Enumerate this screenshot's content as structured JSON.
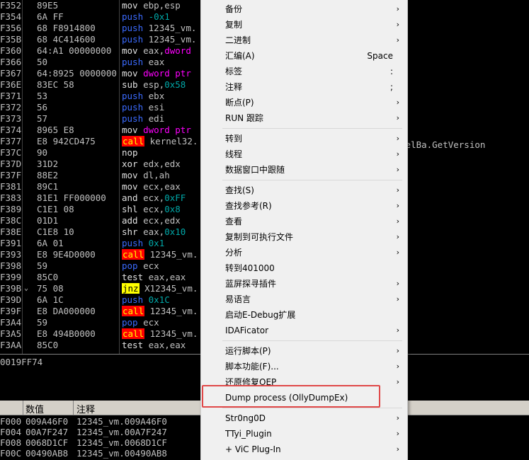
{
  "disasm": {
    "rows": [
      {
        "addr": "F352",
        "hex": "89E5",
        "mn": "mov",
        "op": [
          [
            "t",
            "ebp,esp"
          ]
        ]
      },
      {
        "addr": "F354",
        "hex": "6A FF",
        "mn": "push",
        "op": [
          [
            "n",
            "-0x1"
          ]
        ]
      },
      {
        "addr": "F356",
        "hex": "68 F8914800",
        "mn": "push",
        "op": [
          [
            "t",
            "12345_vm."
          ]
        ]
      },
      {
        "addr": "F35B",
        "hex": "68 4C414600",
        "mn": "push",
        "op": [
          [
            "t",
            "12345_vm."
          ]
        ]
      },
      {
        "addr": "F360",
        "hex": "64:A1 00000000",
        "mn": "mov",
        "op": [
          [
            "t",
            "eax,"
          ],
          [
            "k",
            "dword"
          ]
        ]
      },
      {
        "addr": "F366",
        "hex": "50",
        "mn": "push",
        "op": [
          [
            "t",
            "eax"
          ]
        ]
      },
      {
        "addr": "F367",
        "hex": "64:8925 0000000",
        "mn": "mov",
        "op": [
          [
            "k",
            "dword ptr"
          ]
        ]
      },
      {
        "addr": "F36E",
        "hex": "83EC 58",
        "mn": "sub",
        "op": [
          [
            "t",
            "esp,"
          ],
          [
            "n",
            "0x58"
          ]
        ]
      },
      {
        "addr": "F371",
        "hex": "53",
        "mn": "push",
        "op": [
          [
            "t",
            "ebx"
          ]
        ]
      },
      {
        "addr": "F372",
        "hex": "56",
        "mn": "push",
        "op": [
          [
            "t",
            "esi"
          ]
        ]
      },
      {
        "addr": "F373",
        "hex": "57",
        "mn": "push",
        "op": [
          [
            "t",
            "edi"
          ]
        ]
      },
      {
        "addr": "F374",
        "hex": "8965 E8",
        "mn": "mov",
        "op": [
          [
            "k",
            "dword ptr"
          ]
        ]
      },
      {
        "addr": "F377",
        "hex": "E8 942CD475",
        "mn": "call",
        "op": [
          [
            "t",
            "kernel32."
          ]
        ]
      },
      {
        "addr": "F37C",
        "hex": "90",
        "mn": "nop",
        "op": []
      },
      {
        "addr": "F37D",
        "hex": "31D2",
        "mn": "xor",
        "op": [
          [
            "t",
            "edx,edx"
          ]
        ]
      },
      {
        "addr": "F37F",
        "hex": "88E2",
        "mn": "mov",
        "op": [
          [
            "t",
            "dl,ah"
          ]
        ]
      },
      {
        "addr": "F381",
        "hex": "89C1",
        "mn": "mov",
        "op": [
          [
            "t",
            "ecx,eax"
          ]
        ]
      },
      {
        "addr": "F383",
        "hex": "81E1 FF000000",
        "mn": "and",
        "op": [
          [
            "t",
            "ecx,"
          ],
          [
            "n",
            "0xFF"
          ]
        ]
      },
      {
        "addr": "F389",
        "hex": "C1E1 08",
        "mn": "shl",
        "op": [
          [
            "t",
            "ecx,"
          ],
          [
            "n",
            "0x8"
          ]
        ]
      },
      {
        "addr": "F38C",
        "hex": "01D1",
        "mn": "add",
        "op": [
          [
            "t",
            "ecx,edx"
          ]
        ]
      },
      {
        "addr": "F38E",
        "hex": "C1E8 10",
        "mn": "shr",
        "op": [
          [
            "t",
            "eax,"
          ],
          [
            "n",
            "0x10"
          ]
        ]
      },
      {
        "addr": "F391",
        "hex": "6A 01",
        "mn": "push",
        "op": [
          [
            "n",
            "0x1"
          ]
        ]
      },
      {
        "addr": "F393",
        "hex": "E8 9E4D0000",
        "mn": "call",
        "op": [
          [
            "t",
            "12345_vm."
          ]
        ]
      },
      {
        "addr": "F398",
        "hex": "59",
        "mn": "pop",
        "op": [
          [
            "t",
            "ecx"
          ]
        ]
      },
      {
        "addr": "F399",
        "hex": "85C0",
        "mn": "test",
        "op": [
          [
            "t",
            "eax,eax"
          ]
        ]
      },
      {
        "addr": "F39B",
        "hex": "75 08",
        "mn": "jnz",
        "op": [
          [
            "t",
            "X12345_vm."
          ]
        ],
        "mark": "⌄"
      },
      {
        "addr": "F39D",
        "hex": "6A 1C",
        "mn": "push",
        "op": [
          [
            "n",
            "0x1C"
          ]
        ]
      },
      {
        "addr": "F39F",
        "hex": "E8 DA000000",
        "mn": "call",
        "op": [
          [
            "t",
            "12345_vm."
          ]
        ]
      },
      {
        "addr": "F3A4",
        "hex": "59",
        "mn": "pop",
        "op": [
          [
            "t",
            "ecx"
          ]
        ]
      },
      {
        "addr": "F3A5",
        "hex": "E8 494B0000",
        "mn": "call",
        "op": [
          [
            "t",
            "12345_vm."
          ]
        ]
      },
      {
        "addr": "F3AA",
        "hex": "85C0",
        "mn": "test",
        "op": [
          [
            "t",
            "eax,eax"
          ]
        ]
      }
    ],
    "extra_comment": "nelBa.GetVersion"
  },
  "info": {
    "text": "0019FF74"
  },
  "stack": {
    "col_value": "数值",
    "col_comment": "注释",
    "rows": [
      {
        "addr": "F000",
        "value": "009A46F0",
        "comment": "12345_vm.009A46F0"
      },
      {
        "addr": "F004",
        "value": "00A7F247",
        "comment": "12345_vm.00A7F247"
      },
      {
        "addr": "F008",
        "value": "0068D1CF",
        "comment": "12345_vm.0068D1CF"
      },
      {
        "addr": "F00C",
        "value": "00490AB8",
        "comment": "12345_vm.00490AB8"
      }
    ]
  },
  "menu": {
    "items": [
      {
        "label": "备份",
        "arrow": true,
        "name": "menu-item-backup"
      },
      {
        "label": "复制",
        "arrow": true,
        "name": "menu-item-copy"
      },
      {
        "label": "二进制",
        "arrow": true,
        "name": "menu-item-binary"
      },
      {
        "label": "汇编(A)",
        "shortcut": "Space",
        "name": "menu-item-assemble"
      },
      {
        "label": "标签",
        "shortcut": ":",
        "name": "menu-item-label"
      },
      {
        "label": "注释",
        "shortcut": ";",
        "name": "menu-item-comment"
      },
      {
        "label": "断点(P)",
        "arrow": true,
        "name": "menu-item-breakpoint"
      },
      {
        "label": "RUN 跟踪",
        "arrow": true,
        "name": "menu-item-run-trace"
      },
      {
        "sep": true
      },
      {
        "label": "转到",
        "arrow": true,
        "name": "menu-item-goto"
      },
      {
        "label": "线程",
        "arrow": true,
        "name": "menu-item-threads"
      },
      {
        "label": "数据窗口中跟随",
        "arrow": true,
        "name": "menu-item-follow-in-dump"
      },
      {
        "sep": true
      },
      {
        "label": "查找(S)",
        "arrow": true,
        "name": "menu-item-search"
      },
      {
        "label": "查找参考(R)",
        "arrow": true,
        "name": "menu-item-find-references"
      },
      {
        "label": "查看",
        "arrow": true,
        "name": "menu-item-view"
      },
      {
        "label": "复制到可执行文件",
        "arrow": true,
        "name": "menu-item-copy-to-executable"
      },
      {
        "label": "分析",
        "arrow": true,
        "name": "menu-item-analysis"
      },
      {
        "label": "转到401000",
        "name": "menu-item-goto-401000"
      },
      {
        "label": "蓝屏探寻插件",
        "arrow": true,
        "name": "menu-item-bsod-plugin"
      },
      {
        "label": "易语言",
        "arrow": true,
        "name": "menu-item-e-language"
      },
      {
        "label": "启动E-Debug扩展",
        "name": "menu-item-e-debug"
      },
      {
        "label": "IDAFicator",
        "arrow": true,
        "name": "menu-item-idaficator"
      },
      {
        "sep": true
      },
      {
        "label": "运行脚本(P)",
        "arrow": true,
        "name": "menu-item-run-script"
      },
      {
        "label": "脚本功能(F)...",
        "arrow": true,
        "name": "menu-item-script-functions"
      },
      {
        "label": "还原修复OEP",
        "arrow": true,
        "name": "menu-item-restore-oep"
      },
      {
        "label": "Dump process (OllyDumpEx)",
        "name": "menu-item-dump-process"
      },
      {
        "sep": true
      },
      {
        "label": "Str0ng0D",
        "arrow": true,
        "name": "menu-item-strongod"
      },
      {
        "label": "TTyi_Plugin",
        "arrow": true,
        "name": "menu-item-ttyi-plugin"
      },
      {
        "label": "+ ViC Plug-In",
        "arrow": true,
        "name": "menu-item-vic-plugin"
      }
    ]
  },
  "colors": {
    "menu_bg": "#f0f0f0",
    "highlight_border": "#e04848",
    "call_bg": "#ff0000",
    "jnz_bg": "#ffff00",
    "push_fg": "#3b6bff"
  }
}
